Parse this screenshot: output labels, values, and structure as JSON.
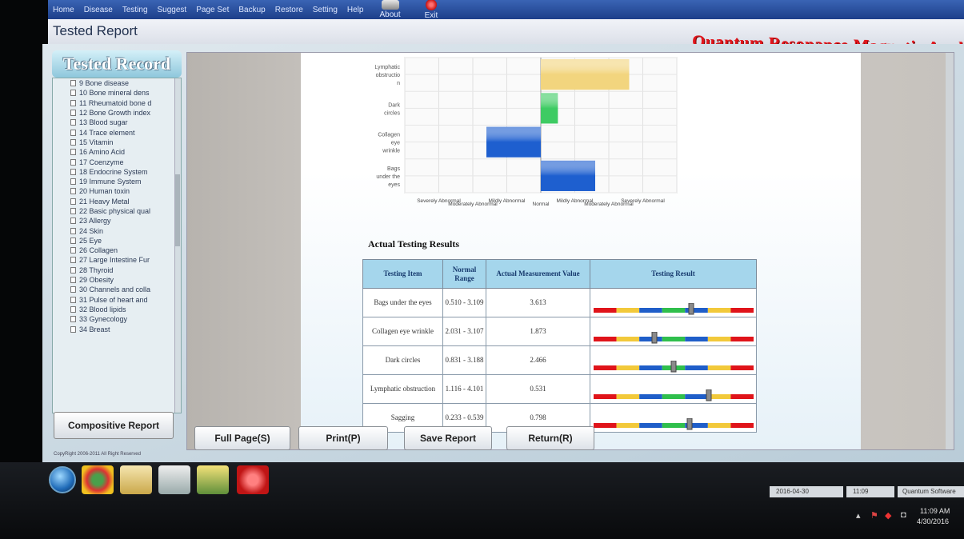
{
  "menu": {
    "items": [
      "Home",
      "Disease",
      "Testing",
      "Suggest",
      "Page Set",
      "Backup",
      "Restore",
      "Setting",
      "Help"
    ],
    "about": "About",
    "exit": "Exit"
  },
  "window": {
    "title": "Tested Report",
    "brand": "Quantum Resonance Magnetic Analyzer"
  },
  "left_panel": {
    "header": "Tested Record",
    "items": [
      "9 Bone disease",
      "10 Bone mineral dens",
      "11 Rheumatoid bone d",
      "12 Bone Growth index",
      "13 Blood sugar",
      "14 Trace element",
      "15 Vitamin",
      "16 Amino Acid",
      "17 Coenzyme",
      "18 Endocrine System",
      "19 Immune System",
      "20 Human toxin",
      "21 Heavy Metal",
      "22 Basic physical qual",
      "23 Allergy",
      "24 Skin",
      "25 Eye",
      "26 Collagen",
      "27 Large Intestine Fur",
      "28 Thyroid",
      "29 Obesity",
      "30 Channels and colla",
      "31 Pulse of heart and",
      "32 Blood lipids",
      "33 Gynecology",
      "34 Breast"
    ],
    "composite_button": "Compositive Report",
    "copyright": "CopyRight 2006-2011 All Right Reserved"
  },
  "chart_data": {
    "type": "bar",
    "categories": [
      "Lymphatic obstructio n",
      "Dark circles",
      "Collagen eye wrinkle",
      "Bags under the eyes"
    ],
    "values": [
      2.6,
      0.5,
      -1.6,
      1.6
    ],
    "colors": [
      "#f2d57e",
      "#3ecb63",
      "#1e5fcf",
      "#1e5fcf"
    ],
    "xlim": [
      -4,
      4
    ],
    "grid": true,
    "x_tick_labels": [
      "Severely Abnormal",
      "Moderately Abnormal",
      "Mildly Abnormal",
      "Normal",
      "Mildly Abnormal",
      "Moderately Abnormal",
      "Severely Abnormal"
    ],
    "x_tick_positions": [
      -3,
      -2,
      -1,
      0,
      1,
      2,
      3
    ]
  },
  "results": {
    "title": "Actual Testing Results",
    "headers": [
      "Testing Item",
      "Normal Range",
      "Actual Measurement Value",
      "Testing Result"
    ],
    "rows": [
      {
        "item": "Bags under the eyes",
        "range": "0.510 - 3.109",
        "value": "3.613",
        "indicator": 0.61
      },
      {
        "item": "Collagen eye wrinkle",
        "range": "2.031 - 3.107",
        "value": "1.873",
        "indicator": 0.38
      },
      {
        "item": "Dark circles",
        "range": "0.831 - 3.188",
        "value": "2.466",
        "indicator": 0.5
      },
      {
        "item": "Lymphatic obstruction",
        "range": "1.116 - 4.101",
        "value": "0.531",
        "indicator": 0.72
      },
      {
        "item": "Sagging",
        "range": "0.233 - 0.539",
        "value": "0.798",
        "indicator": 0.6
      }
    ]
  },
  "buttons": {
    "full_page": "Full Page(S)",
    "print": "Print(P)",
    "save": "Save Report",
    "return": "Return(R)"
  },
  "taskbar": {
    "status_date": "2016-04-30",
    "status_time": "11:09",
    "status_app": "Quantum Software",
    "clock_time": "11:09 AM",
    "clock_date": "4/30/2016"
  },
  "colors": {
    "menubar": "#2a4f9c",
    "brand": "#e2151b",
    "table_header": "#a5d6ec"
  }
}
